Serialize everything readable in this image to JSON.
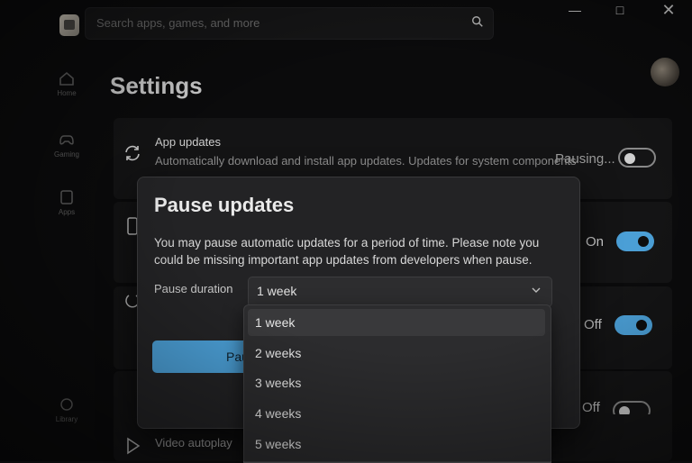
{
  "search": {
    "placeholder": "Search apps, games, and more"
  },
  "nav": [
    {
      "label": "Home"
    },
    {
      "label": "Gaming"
    },
    {
      "label": "Apps"
    },
    {
      "label": "Library"
    }
  ],
  "page": {
    "title": "Settings"
  },
  "settings": {
    "app_updates": {
      "title": "App updates",
      "description": "Automatically download and install app updates. Updates for system components",
      "state": "Pausing..."
    },
    "row2": {
      "state": "On"
    },
    "row3": {
      "state": "Off"
    },
    "row4": {
      "state": "Off"
    },
    "video_autoplay": {
      "title": "Video autoplay"
    }
  },
  "dialog": {
    "title": "Pause updates",
    "body": "You may pause automatic updates for a period of time. Please note you could be missing important app updates from developers when pause.",
    "duration_label": "Pause duration",
    "selected": "1 week",
    "primary_button": "Pause"
  },
  "dropdown": {
    "options": [
      "1 week",
      "2 weeks",
      "3 weeks",
      "4 weeks",
      "5 weeks"
    ]
  },
  "colors": {
    "accent": "#4b9fd6",
    "surface": "#232325",
    "background": "#0b0b0c"
  }
}
